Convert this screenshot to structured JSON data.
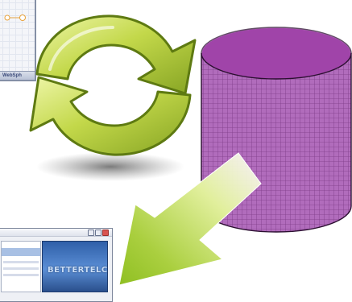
{
  "top_window": {
    "status_text": "WebSph"
  },
  "bottom_window": {
    "brand_text": "BETTERTELCO"
  },
  "colors": {
    "sync_arrows": "#b7cf3c",
    "database_fill": "#a85fb3",
    "database_top": "#a044a9",
    "download_arrow": "#9fc734"
  },
  "icons": [
    "sync-arrows-icon",
    "database-icon",
    "download-arrow-icon"
  ]
}
